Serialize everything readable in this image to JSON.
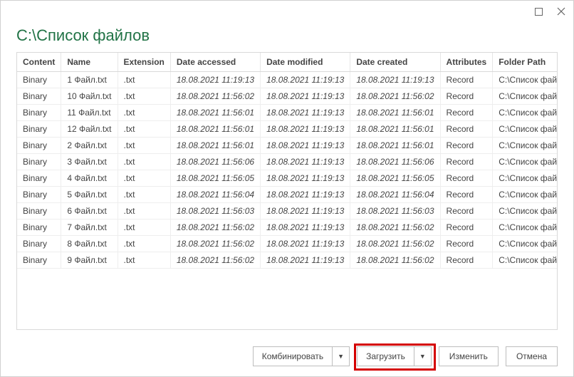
{
  "heading": "C:\\Список файлов",
  "columns": [
    "Content",
    "Name",
    "Extension",
    "Date accessed",
    "Date modified",
    "Date created",
    "Attributes",
    "Folder Path"
  ],
  "rows": [
    {
      "content": "Binary",
      "name": "1 Файл.txt",
      "ext": ".txt",
      "accessed": "18.08.2021 11:19:13",
      "modified": "18.08.2021 11:19:13",
      "created": "18.08.2021 11:19:13",
      "attrs": "Record",
      "path": "C:\\Список файлов\\"
    },
    {
      "content": "Binary",
      "name": "10 Файл.txt",
      "ext": ".txt",
      "accessed": "18.08.2021 11:56:02",
      "modified": "18.08.2021 11:19:13",
      "created": "18.08.2021 11:56:02",
      "attrs": "Record",
      "path": "C:\\Список файлов\\"
    },
    {
      "content": "Binary",
      "name": "11 Файл.txt",
      "ext": ".txt",
      "accessed": "18.08.2021 11:56:01",
      "modified": "18.08.2021 11:19:13",
      "created": "18.08.2021 11:56:01",
      "attrs": "Record",
      "path": "C:\\Список файлов\\"
    },
    {
      "content": "Binary",
      "name": "12 Файл.txt",
      "ext": ".txt",
      "accessed": "18.08.2021 11:56:01",
      "modified": "18.08.2021 11:19:13",
      "created": "18.08.2021 11:56:01",
      "attrs": "Record",
      "path": "C:\\Список файлов\\"
    },
    {
      "content": "Binary",
      "name": "2 Файл.txt",
      "ext": ".txt",
      "accessed": "18.08.2021 11:56:01",
      "modified": "18.08.2021 11:19:13",
      "created": "18.08.2021 11:56:01",
      "attrs": "Record",
      "path": "C:\\Список файлов\\"
    },
    {
      "content": "Binary",
      "name": "3 Файл.txt",
      "ext": ".txt",
      "accessed": "18.08.2021 11:56:06",
      "modified": "18.08.2021 11:19:13",
      "created": "18.08.2021 11:56:06",
      "attrs": "Record",
      "path": "C:\\Список файлов\\"
    },
    {
      "content": "Binary",
      "name": "4 Файл.txt",
      "ext": ".txt",
      "accessed": "18.08.2021 11:56:05",
      "modified": "18.08.2021 11:19:13",
      "created": "18.08.2021 11:56:05",
      "attrs": "Record",
      "path": "C:\\Список файлов\\"
    },
    {
      "content": "Binary",
      "name": "5 Файл.txt",
      "ext": ".txt",
      "accessed": "18.08.2021 11:56:04",
      "modified": "18.08.2021 11:19:13",
      "created": "18.08.2021 11:56:04",
      "attrs": "Record",
      "path": "C:\\Список файлов\\"
    },
    {
      "content": "Binary",
      "name": "6 Файл.txt",
      "ext": ".txt",
      "accessed": "18.08.2021 11:56:03",
      "modified": "18.08.2021 11:19:13",
      "created": "18.08.2021 11:56:03",
      "attrs": "Record",
      "path": "C:\\Список файлов\\"
    },
    {
      "content": "Binary",
      "name": "7 Файл.txt",
      "ext": ".txt",
      "accessed": "18.08.2021 11:56:02",
      "modified": "18.08.2021 11:19:13",
      "created": "18.08.2021 11:56:02",
      "attrs": "Record",
      "path": "C:\\Список файлов\\"
    },
    {
      "content": "Binary",
      "name": "8 Файл.txt",
      "ext": ".txt",
      "accessed": "18.08.2021 11:56:02",
      "modified": "18.08.2021 11:19:13",
      "created": "18.08.2021 11:56:02",
      "attrs": "Record",
      "path": "C:\\Список файлов\\"
    },
    {
      "content": "Binary",
      "name": "9 Файл.txt",
      "ext": ".txt",
      "accessed": "18.08.2021 11:56:02",
      "modified": "18.08.2021 11:19:13",
      "created": "18.08.2021 11:56:02",
      "attrs": "Record",
      "path": "C:\\Список файлов\\"
    }
  ],
  "buttons": {
    "combine": "Комбинировать",
    "load": "Загрузить",
    "edit": "Изменить",
    "cancel": "Отмена"
  }
}
